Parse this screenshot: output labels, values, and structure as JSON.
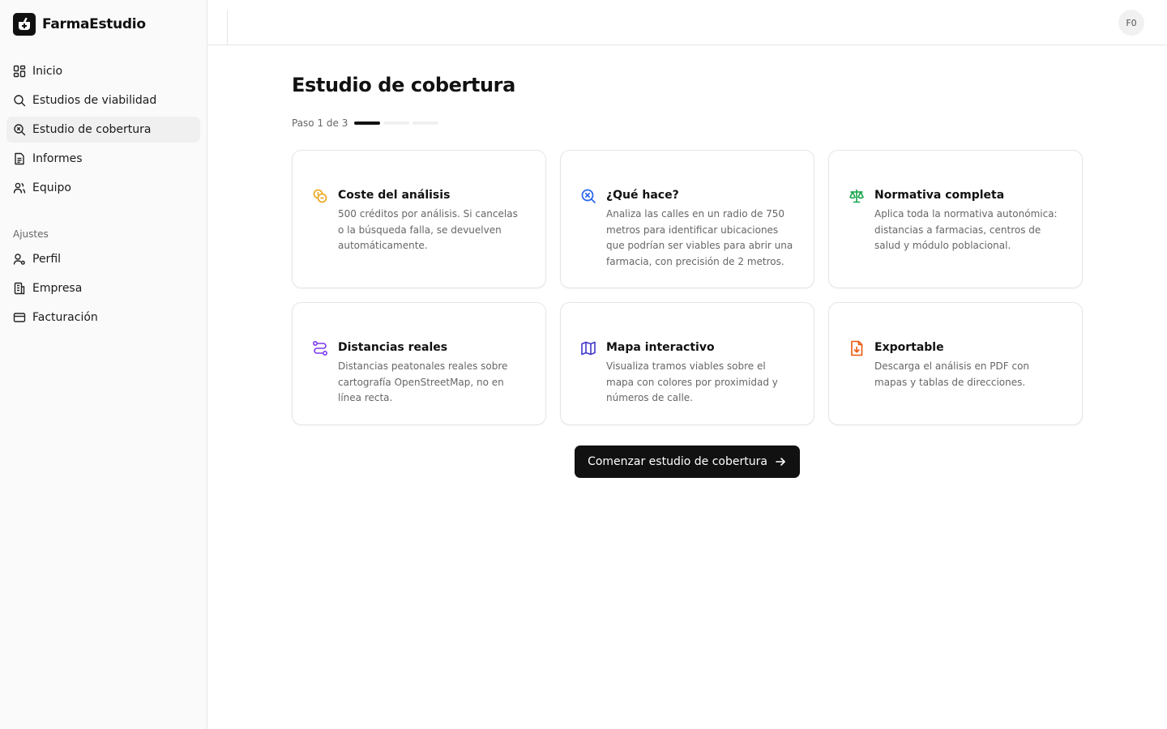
{
  "app": {
    "name": "FarmaEstudio"
  },
  "sidebar": {
    "main_items": [
      {
        "label": "Inicio",
        "icon": "dashboard-icon",
        "active": false
      },
      {
        "label": "Estudios de viabilidad",
        "icon": "search-icon",
        "active": false
      },
      {
        "label": "Estudio de cobertura",
        "icon": "search-x-icon",
        "active": true
      },
      {
        "label": "Informes",
        "icon": "document-icon",
        "active": false
      },
      {
        "label": "Equipo",
        "icon": "users-icon",
        "active": false
      }
    ],
    "settings_label": "Ajustes",
    "settings_items": [
      {
        "label": "Perfil",
        "icon": "user-icon"
      },
      {
        "label": "Empresa",
        "icon": "building-icon"
      },
      {
        "label": "Facturación",
        "icon": "credit-card-icon"
      }
    ]
  },
  "header": {
    "avatar_initials": "F0"
  },
  "main": {
    "title": "Estudio de cobertura",
    "stepper": {
      "text": "Paso 1 de 3",
      "current": 1,
      "total": 3
    },
    "cards": [
      {
        "title": "Coste del análisis",
        "desc": "500 créditos por análisis. Si cancelas o la búsqueda falla, se devuelven automáticamente.",
        "icon": "coins-icon",
        "color": "#e8a317"
      },
      {
        "title": "¿Qué hace?",
        "desc": "Analiza las calles en un radio de 750 metros para identificar ubicaciones que podrían ser viables para abrir una farmacia, con precisión de 2 metros.",
        "icon": "search-x-icon",
        "color": "#2563eb"
      },
      {
        "title": "Normativa completa",
        "desc": "Aplica toda la normativa autonómica: distancias a farmacias, centros de salud y módulo poblacional.",
        "icon": "scale-icon",
        "color": "#16a34a"
      },
      {
        "title": "Distancias reales",
        "desc": "Distancias peatonales reales sobre cartografía OpenStreetMap, no en línea recta.",
        "icon": "route-icon",
        "color": "#7c3aed"
      },
      {
        "title": "Mapa interactivo",
        "desc": "Visualiza tramos viables sobre el mapa con colores por proximidad y números de calle.",
        "icon": "map-icon",
        "color": "#4338ca"
      },
      {
        "title": "Exportable",
        "desc": "Descarga el análisis en PDF con mapas y tablas de direcciones.",
        "icon": "file-download-icon",
        "color": "#ea580c"
      }
    ],
    "cta_label": "Comenzar estudio de cobertura"
  }
}
